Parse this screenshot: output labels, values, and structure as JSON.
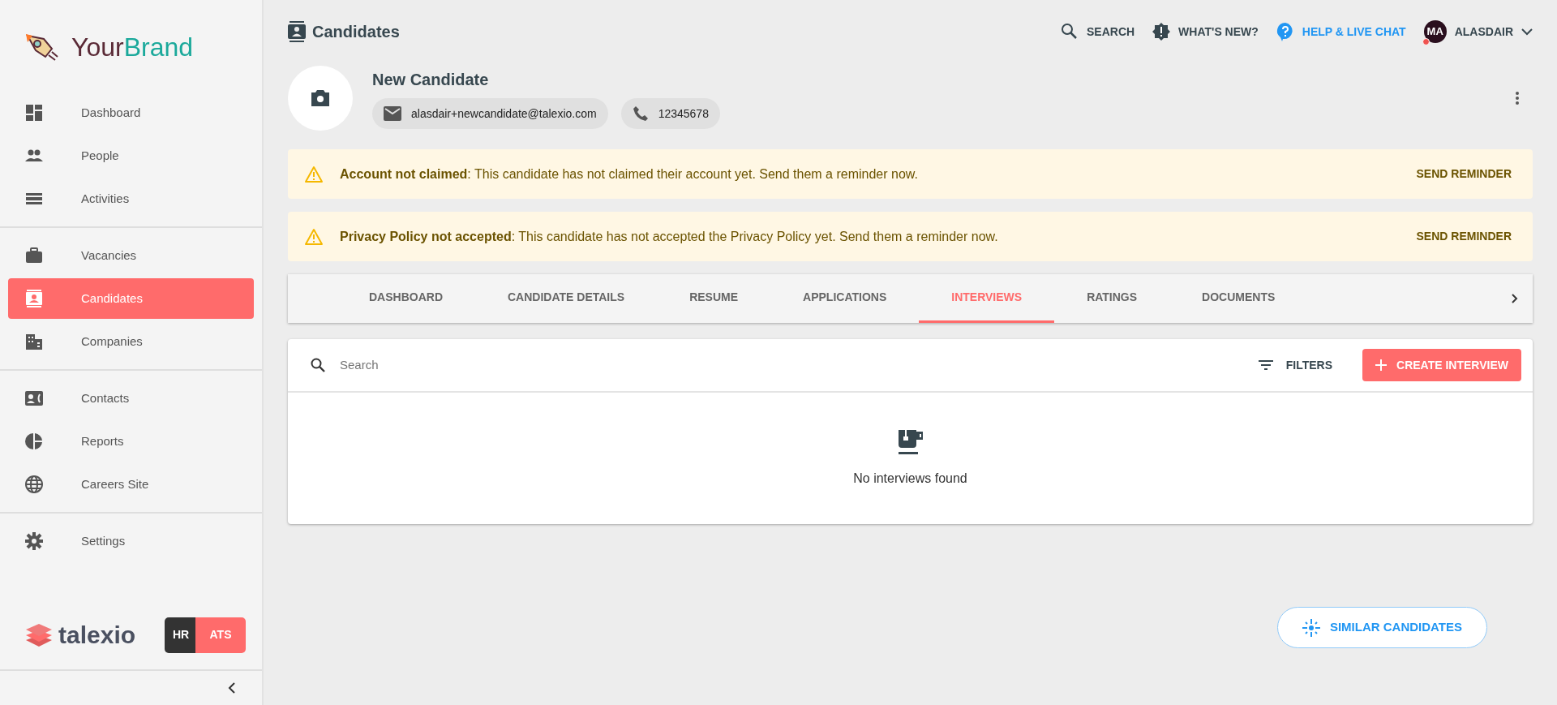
{
  "brand": {
    "first": "Your",
    "second": "Brand"
  },
  "sidebar": {
    "sections": [
      {
        "items": [
          {
            "label": "Dashboard",
            "selected": false
          },
          {
            "label": "People",
            "selected": false
          },
          {
            "label": "Activities",
            "selected": false
          }
        ]
      },
      {
        "items": [
          {
            "label": "Vacancies",
            "selected": false
          },
          {
            "label": "Candidates",
            "selected": true
          },
          {
            "label": "Companies",
            "selected": false
          }
        ]
      },
      {
        "items": [
          {
            "label": "Contacts",
            "selected": false
          },
          {
            "label": "Reports",
            "selected": false
          },
          {
            "label": "Careers Site",
            "selected": false
          }
        ]
      },
      {
        "items": [
          {
            "label": "Settings",
            "selected": false
          }
        ]
      }
    ]
  },
  "footer_logo": "talexio",
  "app_switch": [
    {
      "label": "HR",
      "selected": false
    },
    {
      "label": "ATS",
      "selected": true
    }
  ],
  "page_title": "Candidates",
  "top_nav": [
    {
      "label": "SEARCH",
      "kind": "search"
    },
    {
      "label": "WHAT'S NEW?",
      "kind": "news"
    },
    {
      "label": "HELP & LIVE CHAT",
      "kind": "help"
    }
  ],
  "user": {
    "initials": "MA",
    "name": "ALASDAIR"
  },
  "candidate": {
    "name": "New Candidate",
    "email": "alasdair+newcandidate@talexio.com",
    "phone": "12345678"
  },
  "alerts": [
    {
      "text": "**Account not claimed**: This candidate has not claimed their account yet. Send them a reminder now.",
      "action": "SEND REMINDER"
    },
    {
      "text": "**Privacy Policy not accepted**: This candidate has not accepted the Privacy Policy yet. Send them a reminder now.",
      "action": "SEND REMINDER"
    }
  ],
  "tabs": [
    {
      "label": "DASHBOARD",
      "selected": false
    },
    {
      "label": "CANDIDATE DETAILS",
      "selected": false
    },
    {
      "label": "RESUME",
      "selected": false
    },
    {
      "label": "APPLICATIONS",
      "selected": false
    },
    {
      "label": "INTERVIEWS",
      "selected": true
    },
    {
      "label": "RATINGS",
      "selected": false
    },
    {
      "label": "DOCUMENTS",
      "selected": false
    }
  ],
  "search": {
    "placeholder": "Search"
  },
  "filters_label": "FILTERS",
  "create_button": "CREATE INTERVIEW",
  "empty_message": "No interviews found",
  "similar_button": "SIMILAR CANDIDATES"
}
